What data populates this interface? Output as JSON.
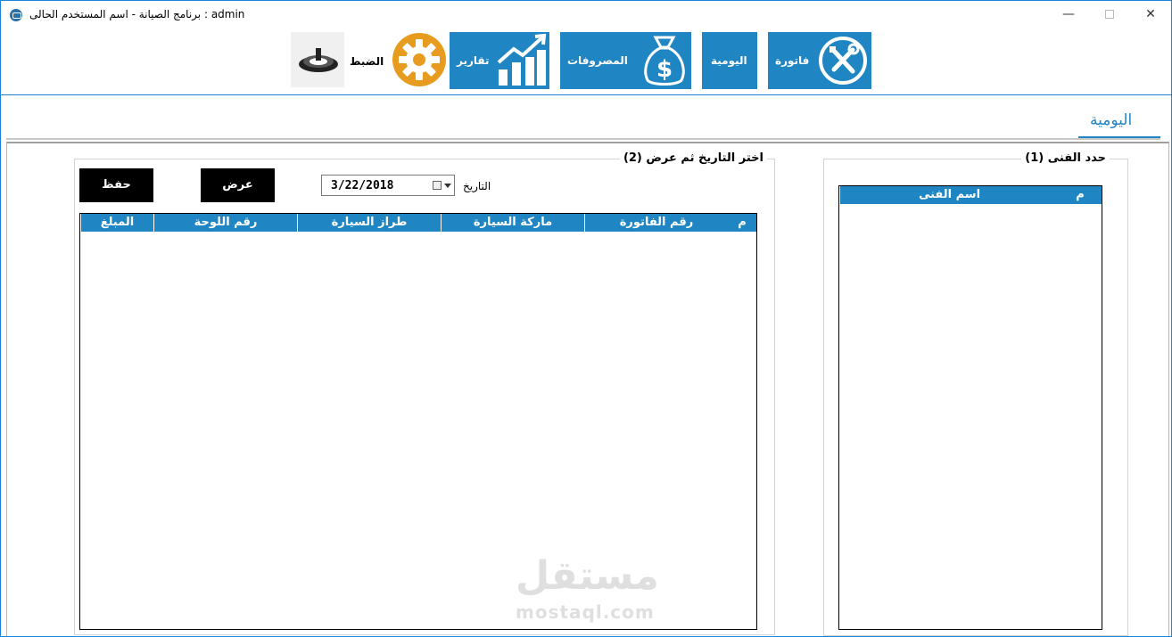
{
  "window": {
    "title": "برنامج الصيانة  -  اسم المستخدم الحالى  :  admin",
    "minimize": "—",
    "close": "✕"
  },
  "toolbar": {
    "invoice": {
      "label": "فاتورة",
      "icon": "tools-icon"
    },
    "daily": {
      "label": "اليومية"
    },
    "expenses": {
      "label": "المصروفات",
      "icon": "money-bag-icon"
    },
    "reports": {
      "label": "تقارير",
      "icon": "bar-chart-icon"
    },
    "settings": {
      "label": "الضبط",
      "icon": "gear-icon",
      "color": "#e89c1f"
    },
    "logout": {
      "icon": "power-icon"
    }
  },
  "tab": {
    "label": "اليومية"
  },
  "technician_panel": {
    "title": "(1) حدد الفنى",
    "columns": [
      "م",
      "اسم الفنى"
    ],
    "rows": []
  },
  "daily_panel": {
    "title": "(2) اختر التاريخ ثم عرض",
    "date_label": "التاريخ",
    "date_value": "3/22/2018",
    "show_button": "عرض",
    "save_button": "حفظ",
    "columns": [
      "م",
      "رقم الفاتورة",
      "ماركة السيارة",
      "طراز السيارة",
      "رقم اللوحة",
      "المبلغ"
    ],
    "rows": []
  },
  "watermark": {
    "arabic": "مستقل",
    "latin": "mostaql.com"
  },
  "colors": {
    "accent": "#1f86c3",
    "button_dark": "#000000",
    "gear": "#e89c1f"
  }
}
